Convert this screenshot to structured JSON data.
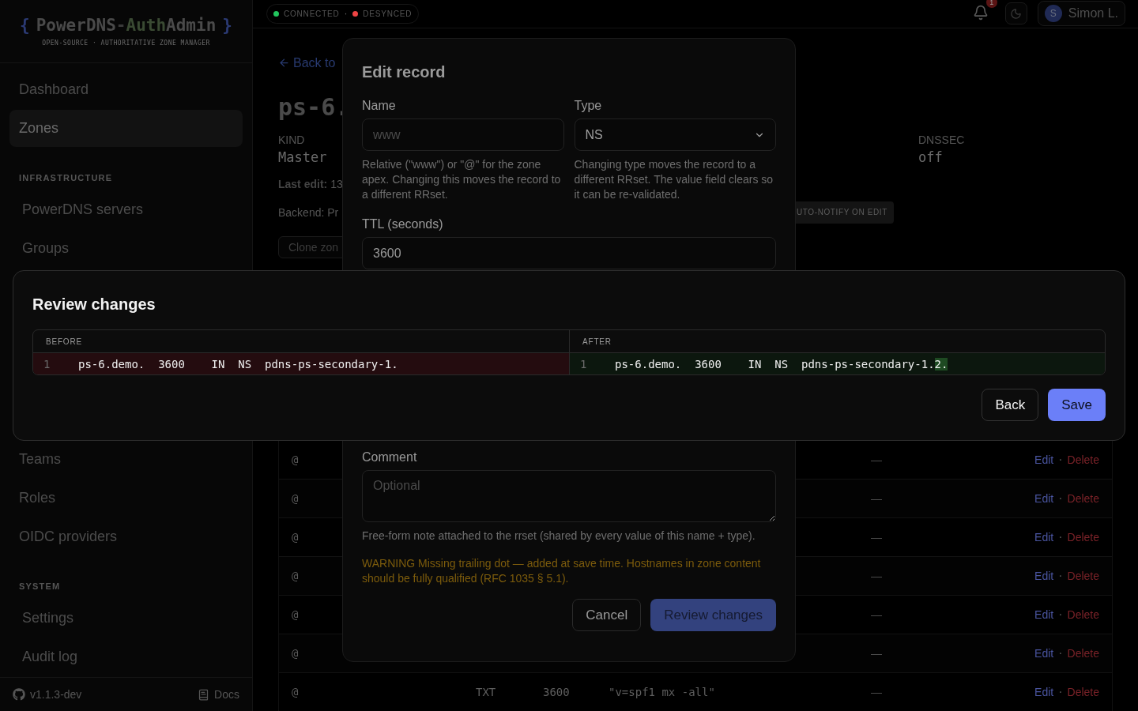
{
  "sidebar": {
    "logo": [
      {
        "text": "{",
        "kind": "brace"
      },
      {
        "text": "PowerDNS",
        "kind": "main"
      },
      {
        "text": "-",
        "kind": "dash"
      },
      {
        "text": "Auth",
        "kind": "accent"
      },
      {
        "text": "Admin",
        "kind": "main"
      },
      {
        "text": "}",
        "kind": "brace"
      }
    ],
    "tagline": "OPEN-SOURCE · AUTHORITATIVE ZONE MANAGER",
    "nav": [
      {
        "items": [
          {
            "label": "Dashboard",
            "selected": false
          },
          {
            "label": "Zones",
            "selected": true
          }
        ]
      },
      {
        "header": "INFRASTRUCTURE",
        "items": [
          {
            "label": "PowerDNS servers",
            "selected": false
          },
          {
            "label": "Groups",
            "selected": false
          }
        ]
      }
    ],
    "nav_lower": [
      {
        "items": [
          {
            "label": "Teams",
            "selected": false
          },
          {
            "label": "Roles",
            "selected": false
          },
          {
            "label": "OIDC providers",
            "selected": false
          }
        ]
      },
      {
        "header": "SYSTEM",
        "items": [
          {
            "label": "Settings",
            "selected": false
          },
          {
            "label": "Audit log",
            "selected": false
          }
        ]
      }
    ],
    "footer": {
      "version": "v1.1.3-dev",
      "docs": "Docs"
    }
  },
  "topbar": {
    "status": [
      {
        "label": "CONNECTED",
        "color": "#22c55e"
      },
      {
        "label": "DESYNCED",
        "color": "#ef4444"
      }
    ],
    "status_separator": "·",
    "notifications": "1",
    "user": {
      "initial": "S",
      "name": "Simon L."
    }
  },
  "zone": {
    "back_link": "Back to",
    "title": "ps-6.",
    "fields": [
      {
        "label": "KIND",
        "value": "Master"
      },
      {
        "label": "DNSSEC",
        "value": "off"
      }
    ],
    "last_edit": {
      "label": "Last edit:",
      "value": "13"
    },
    "backend": "Backend: Pr",
    "badge": "UTO-NOTIFY ON EDIT",
    "clone_button": "Clone zon"
  },
  "records": {
    "rows": [
      {
        "name": "@",
        "comment": "—",
        "separator": "·",
        "actions": [
          {
            "label": "Edit",
            "kind": "edit"
          },
          {
            "label": "Delete",
            "kind": "delete"
          }
        ]
      },
      {
        "name": "@",
        "comment": "—",
        "separator": "·",
        "actions": [
          {
            "label": "Edit",
            "kind": "edit"
          },
          {
            "label": "Delete",
            "kind": "delete"
          }
        ]
      },
      {
        "name": "@",
        "comment": "—",
        "separator": "·",
        "actions": [
          {
            "label": "Edit",
            "kind": "edit"
          },
          {
            "label": "Delete",
            "kind": "delete"
          }
        ]
      },
      {
        "name": "@",
        "comment": "—",
        "separator": "·",
        "actions": [
          {
            "label": "Edit",
            "kind": "edit"
          },
          {
            "label": "Delete",
            "kind": "delete"
          }
        ]
      },
      {
        "name": "@",
        "comment": "—",
        "separator": "·",
        "actions": [
          {
            "label": "Edit",
            "kind": "edit"
          },
          {
            "label": "Delete",
            "kind": "delete"
          }
        ]
      },
      {
        "name": "@",
        "comment": "—",
        "separator": "·",
        "actions": [
          {
            "label": "Edit",
            "kind": "edit"
          },
          {
            "label": "Delete",
            "kind": "delete"
          }
        ]
      },
      {
        "name": "@",
        "type": "TXT",
        "ttl": "3600",
        "content": "\"v=spf1 mx -all\"",
        "comment": "—",
        "separator": "·",
        "actions": [
          {
            "label": "Edit",
            "kind": "edit"
          },
          {
            "label": "Delete",
            "kind": "delete"
          }
        ]
      }
    ]
  },
  "edit_dialog": {
    "title": "Edit record",
    "name_field": {
      "label": "Name",
      "placeholder": "www",
      "help": "Relative (\"www\") or \"@\" for the zone apex. Changing this moves the record to a different RRset."
    },
    "type_field": {
      "label": "Type",
      "value": "NS",
      "help": "Changing type moves the record to a different RRset. The value field clears so it can be re-validated."
    },
    "ttl_field": {
      "label": "TTL (seconds)",
      "value": "3600"
    },
    "comment_field": {
      "label": "Comment",
      "placeholder": "Optional",
      "help": "Free-form note attached to the rrset (shared by every value of this name + type)."
    },
    "warning": "WARNING Missing trailing dot — added at save time. Hostnames in zone content should be fully qualified (RFC 1035 § 5.1).",
    "buttons": [
      {
        "label": "Cancel",
        "kind": "secondary"
      },
      {
        "label": "Review changes",
        "kind": "primary"
      }
    ]
  },
  "review_dialog": {
    "title": "Review changes",
    "panes": [
      {
        "label": "BEFORE",
        "kind": "removed",
        "lines": [
          {
            "number": "1",
            "segments": [
              {
                "text": "ps-6.demo.  3600    IN  NS  pdns-ps-secondary-1.",
                "changed": false
              }
            ]
          }
        ]
      },
      {
        "label": "AFTER",
        "kind": "added",
        "lines": [
          {
            "number": "1",
            "segments": [
              {
                "text": "ps-6.demo.  3600    IN  NS  pdns-ps-secondary-1.",
                "changed": false
              },
              {
                "text": "2.",
                "changed": true
              }
            ]
          }
        ]
      }
    ],
    "buttons": [
      {
        "label": "Back",
        "kind": "secondary"
      },
      {
        "label": "Save",
        "kind": "primary"
      }
    ]
  }
}
